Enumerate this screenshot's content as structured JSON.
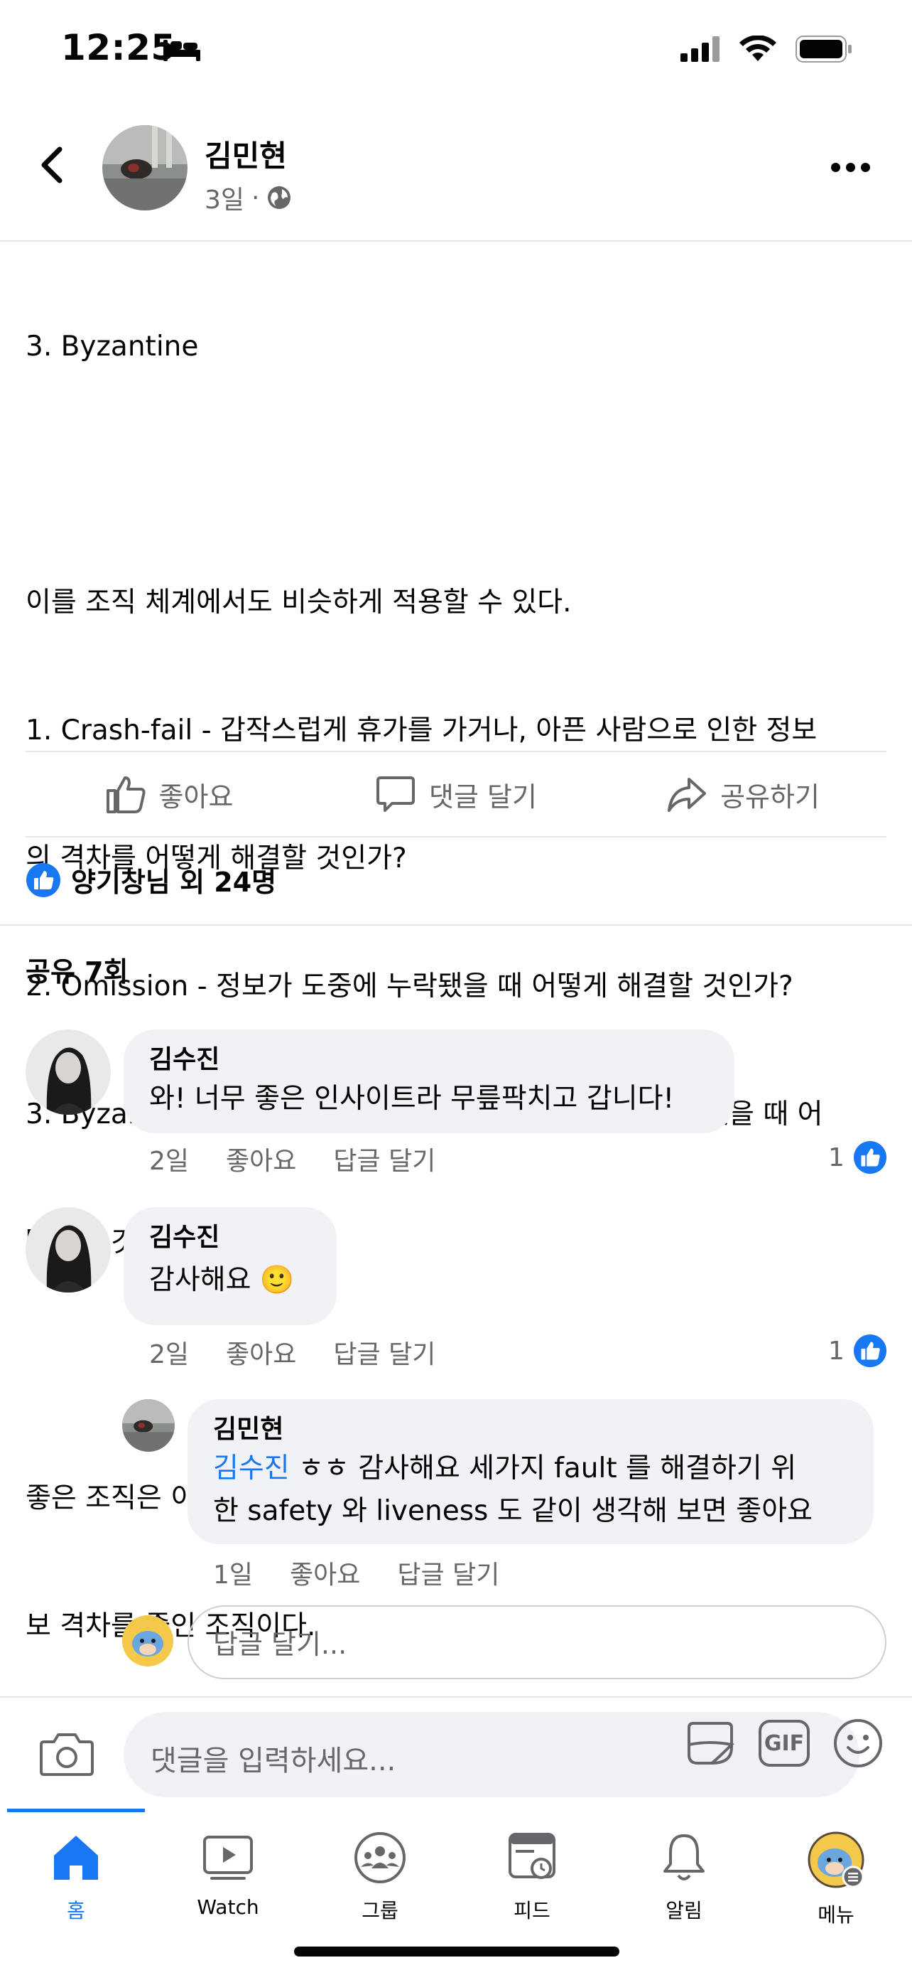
{
  "status": {
    "time": "12:25"
  },
  "post": {
    "author": "김민현",
    "age": "3일",
    "lines": [
      "3. Byzantine",
      "",
      "이를 조직 체계에서도 비슷하게 적용할 수 있다.",
      "1. Crash-fail - 갑작스럽게 휴가를 가거나, 아픈 사람으로 인한 정보",
      "의 격차를 어떻게 해결할 것인가?",
      "2. Omission - 정보가 도중에 누락됐을 때 어떻게 해결할 것인가?",
      "3. Byzantine - 가운데서 정보를 다르게 해석하는 사람이 있을 때 어",
      "떻게할 것인가?",
      "",
      "좋은 조직은 이 세 가지를 시스템적으로 잘 해결해서 구성원들 간의 정",
      "보 격차를 줄인 조직이다."
    ]
  },
  "actions": {
    "like": "좋아요",
    "comment": "댓글 달기",
    "share": "공유하기"
  },
  "reactions": {
    "summary": "양기창님 외 24명"
  },
  "shares": "공유 7회",
  "comments": [
    {
      "author": "김수진",
      "text": "와! 너무 좋은 인사이트라 무릎팍치고 갑니다!",
      "age": "2일",
      "like_label": "좋아요",
      "reply_label": "답글 달기",
      "likes": "1"
    },
    {
      "author": "김수진",
      "text": "감사해요 🙂",
      "age": "2일",
      "like_label": "좋아요",
      "reply_label": "답글 달기",
      "likes": "1"
    }
  ],
  "reply": {
    "author": "김민현",
    "mention": "김수진",
    "line1_rest": " ㅎㅎ 감사해요 세가지 fault 를 해결하기 위",
    "line2": "한 safety 와 liveness 도 같이 생각해 보면 좋아요",
    "age": "1일",
    "like_label": "좋아요",
    "reply_label": "답글 달기"
  },
  "reply_input": {
    "placeholder": "답글 달기..."
  },
  "composer": {
    "placeholder": "댓글을 입력하세요...",
    "gif_label": "GIF"
  },
  "nav": [
    {
      "label": "홈",
      "icon": "home-icon"
    },
    {
      "label": "Watch",
      "icon": "watch-icon"
    },
    {
      "label": "그룹",
      "icon": "groups-icon"
    },
    {
      "label": "피드",
      "icon": "feeds-icon"
    },
    {
      "label": "알림",
      "icon": "bell-icon"
    },
    {
      "label": "메뉴",
      "icon": "menu-avatar-icon"
    }
  ],
  "colors": {
    "accent": "#1877f2",
    "secondary_text": "#65676b",
    "bubble": "#f0f2f5"
  }
}
